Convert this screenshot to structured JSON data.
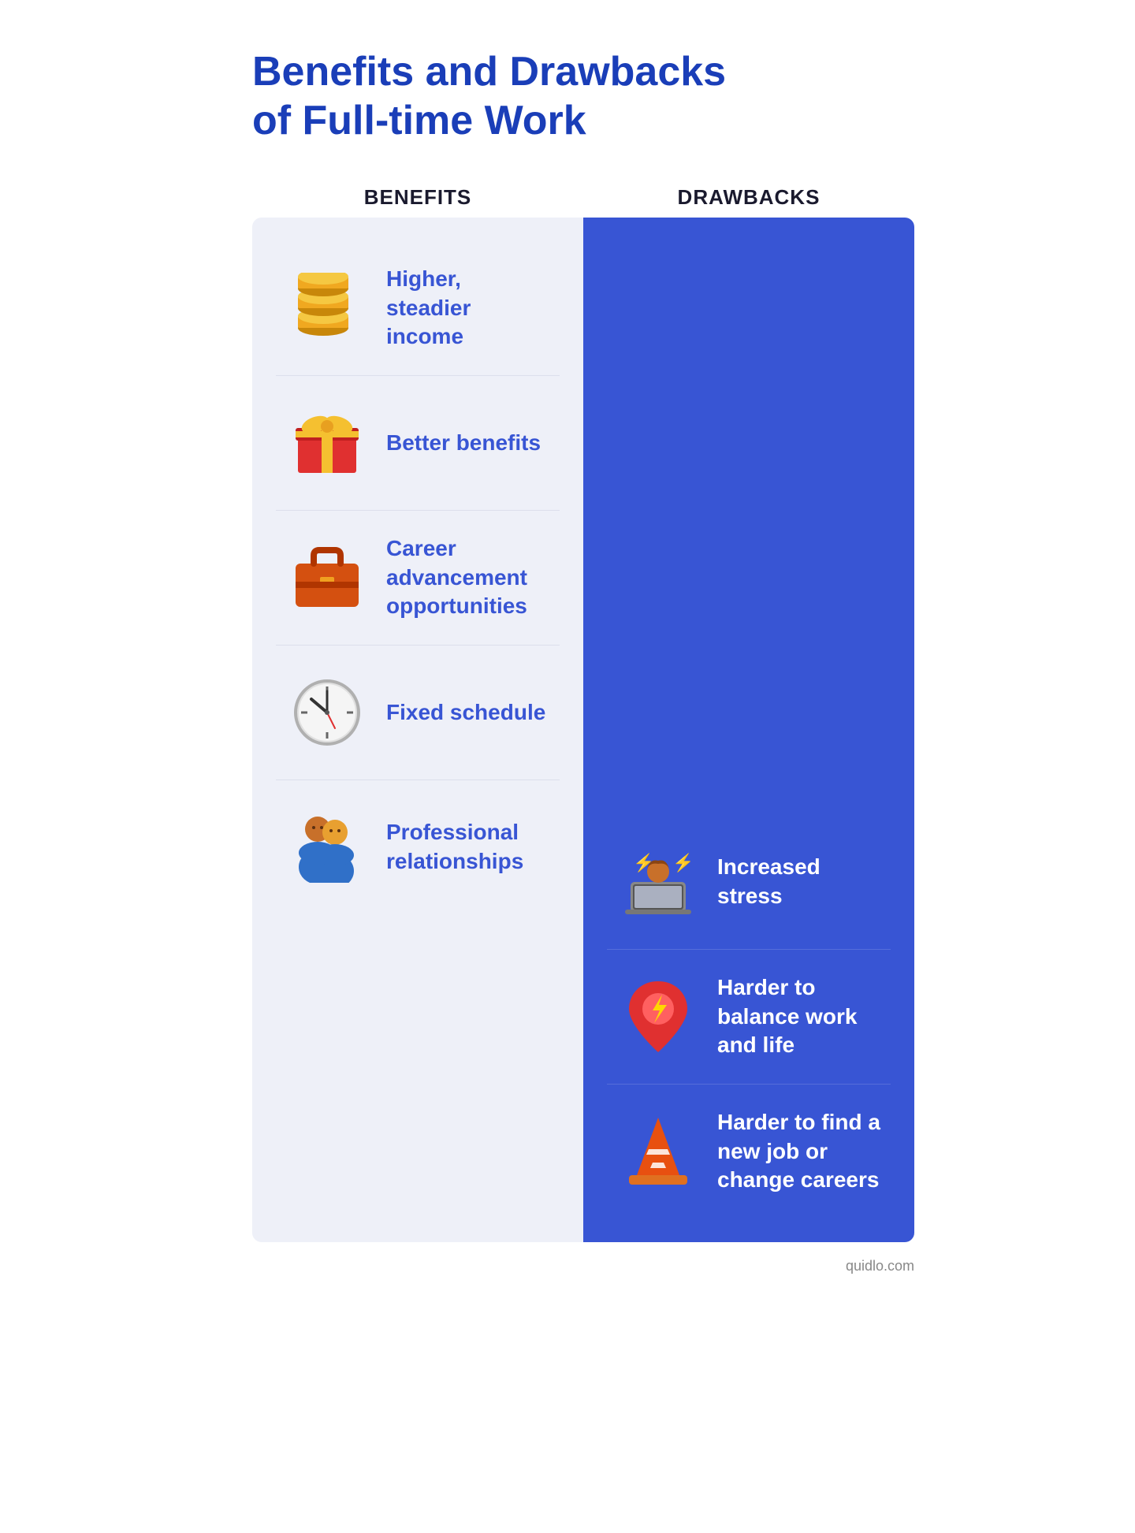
{
  "page": {
    "title_line1": "Benefits and Drawbacks",
    "title_line2": "of Full-time Work",
    "benefits_header": "BENEFITS",
    "drawbacks_header": "DRAWBACKS",
    "footer_credit": "quidlo.com"
  },
  "benefits": [
    {
      "id": "income",
      "text": "Higher, steadier income",
      "icon_name": "coins-icon"
    },
    {
      "id": "benefits",
      "text": "Better benefits",
      "icon_name": "gift-icon"
    },
    {
      "id": "career",
      "text": "Career advancement opportunities",
      "icon_name": "briefcase-icon"
    },
    {
      "id": "schedule",
      "text": "Fixed schedule",
      "icon_name": "clock-icon"
    },
    {
      "id": "professional",
      "text": "Professional relationships",
      "icon_name": "people-icon"
    }
  ],
  "drawbacks": [
    {
      "id": "stress",
      "text": "Increased stress",
      "icon_name": "stress-icon"
    },
    {
      "id": "balance",
      "text": "Harder to balance work and life",
      "icon_name": "location-icon"
    },
    {
      "id": "career-change",
      "text": "Harder to find a new job or change careers",
      "icon_name": "cone-icon"
    }
  ]
}
